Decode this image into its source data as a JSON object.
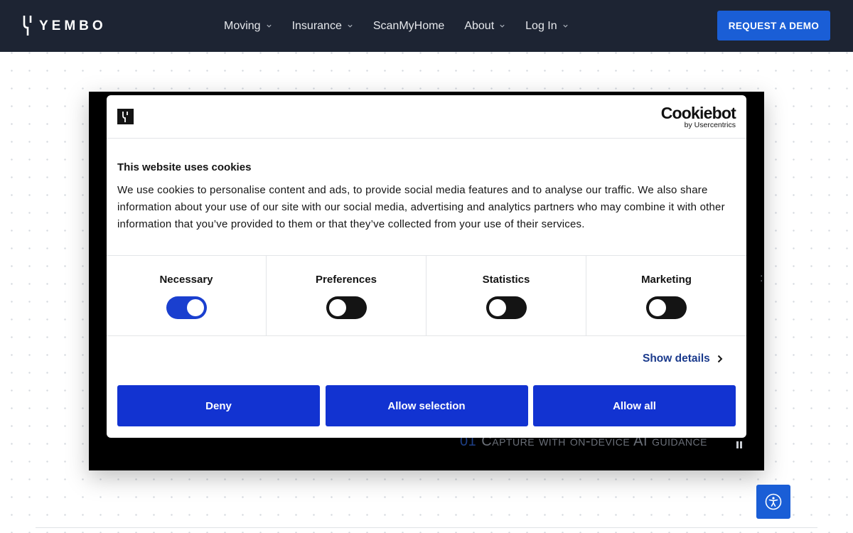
{
  "brand": {
    "name": "YEMBO"
  },
  "nav": {
    "items": [
      {
        "label": "Moving",
        "has_dropdown": true
      },
      {
        "label": "Insurance",
        "has_dropdown": true
      },
      {
        "label": "ScanMyHome",
        "has_dropdown": false
      },
      {
        "label": "About",
        "has_dropdown": true
      },
      {
        "label": "Log In",
        "has_dropdown": true
      }
    ],
    "cta_label": "REQUEST A DEMO"
  },
  "video": {
    "caption_number": "01",
    "caption_text": "Capture with on-device AI guidance",
    "control_icon": "pause-icon"
  },
  "cookie_dialog": {
    "provider_name": "Cookiebot",
    "provider_sub": "by Usercentrics",
    "title": "This website uses cookies",
    "body": "We use cookies to personalise content and ads, to provide social media features and to analyse our traffic. We also share information about your use of our site with our social media, advertising and analytics partners who may combine it with other information that you’ve provided to them or that they’ve collected from your use of their services.",
    "toggles": [
      {
        "label": "Necessary",
        "checked": true
      },
      {
        "label": "Preferences",
        "checked": false
      },
      {
        "label": "Statistics",
        "checked": false
      },
      {
        "label": "Marketing",
        "checked": false
      }
    ],
    "show_details_label": "Show details",
    "buttons": {
      "deny": "Deny",
      "allow_selection": "Allow selection",
      "allow_all": "Allow all"
    }
  },
  "colors": {
    "nav_bg": "#1d2433",
    "cta_blue": "#1a5ed6",
    "cookie_button_blue": "#1233d1",
    "toggle_on": "#1a3fcf",
    "link_blue": "#1a3a8c"
  },
  "accessibility": {
    "icon": "accessibility-icon"
  }
}
